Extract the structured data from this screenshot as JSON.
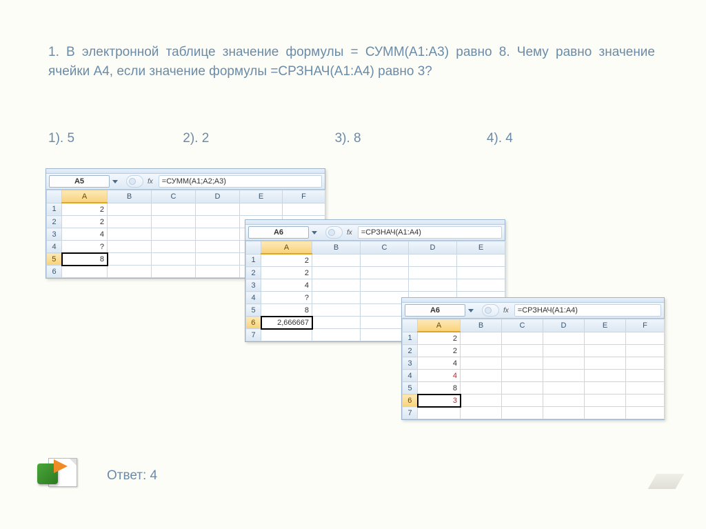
{
  "question": "1. В электронной таблице значение формулы = СУММ(А1:А3) равно 8. Чему равно значение ячейки А4, если значение формулы =СРЗНАЧ(А1:А4) равно 3?",
  "answers": {
    "a1": "1). 5",
    "a2": "2). 2",
    "a3": "3). 8",
    "a4": "4). 4"
  },
  "panel1": {
    "namebox": "A5",
    "formula": "=СУММ(A1;A2;A3)",
    "cols": [
      "A",
      "B",
      "C",
      "D",
      "E",
      "F"
    ],
    "rows": [
      {
        "n": "1",
        "a": "2"
      },
      {
        "n": "2",
        "a": "2"
      },
      {
        "n": "3",
        "a": "4"
      },
      {
        "n": "4",
        "a": "?"
      },
      {
        "n": "5",
        "a": "8",
        "sel": true
      },
      {
        "n": "6",
        "a": ""
      }
    ],
    "activeRow": "5"
  },
  "panel2": {
    "namebox": "A6",
    "formula": "=СРЗНАЧ(A1:A4)",
    "cols": [
      "A",
      "B",
      "C",
      "D",
      "E"
    ],
    "rows": [
      {
        "n": "1",
        "a": "2"
      },
      {
        "n": "2",
        "a": "2"
      },
      {
        "n": "3",
        "a": "4"
      },
      {
        "n": "4",
        "a": "?"
      },
      {
        "n": "5",
        "a": "8"
      },
      {
        "n": "6",
        "a": "2,666667",
        "sel": true
      },
      {
        "n": "7",
        "a": ""
      }
    ],
    "activeRow": "6"
  },
  "panel3": {
    "namebox": "A6",
    "formula": "=СРЗНАЧ(A1:A4)",
    "cols": [
      "A",
      "B",
      "C",
      "D",
      "E",
      "F"
    ],
    "rows": [
      {
        "n": "1",
        "a": "2"
      },
      {
        "n": "2",
        "a": "2"
      },
      {
        "n": "3",
        "a": "4"
      },
      {
        "n": "4",
        "a": "4",
        "red": true
      },
      {
        "n": "5",
        "a": "8"
      },
      {
        "n": "6",
        "a": "3",
        "red": true,
        "sel": true
      },
      {
        "n": "7",
        "a": ""
      }
    ],
    "activeRow": "6"
  },
  "fx": "fx",
  "answer_label": "Ответ: 4"
}
